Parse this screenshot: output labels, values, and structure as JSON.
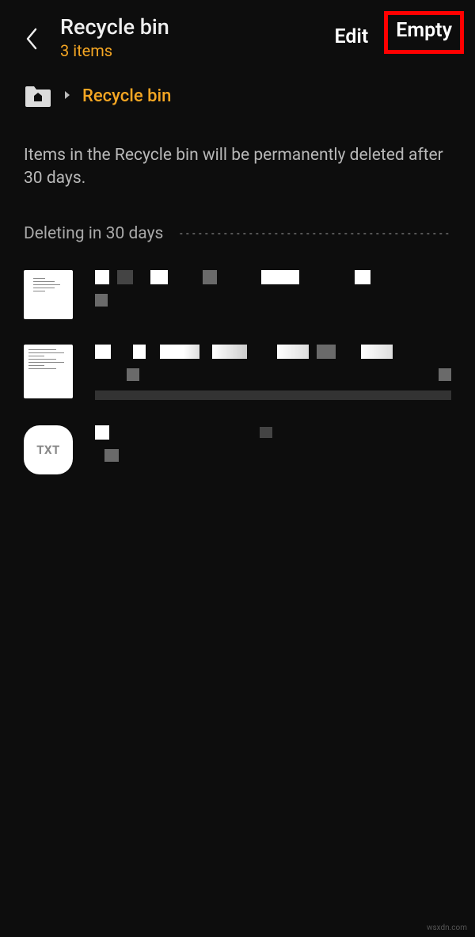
{
  "header": {
    "title": "Recycle bin",
    "subtitle": "3 items",
    "actions": {
      "edit": "Edit",
      "empty": "Empty"
    }
  },
  "breadcrumb": {
    "current": "Recycle bin"
  },
  "info": "Items in the Recycle bin will be permanently deleted after 30 days.",
  "section": {
    "label": "Deleting in 30 days"
  },
  "files": {
    "txt_label": "TXT"
  },
  "watermark": "wsxdn.com"
}
